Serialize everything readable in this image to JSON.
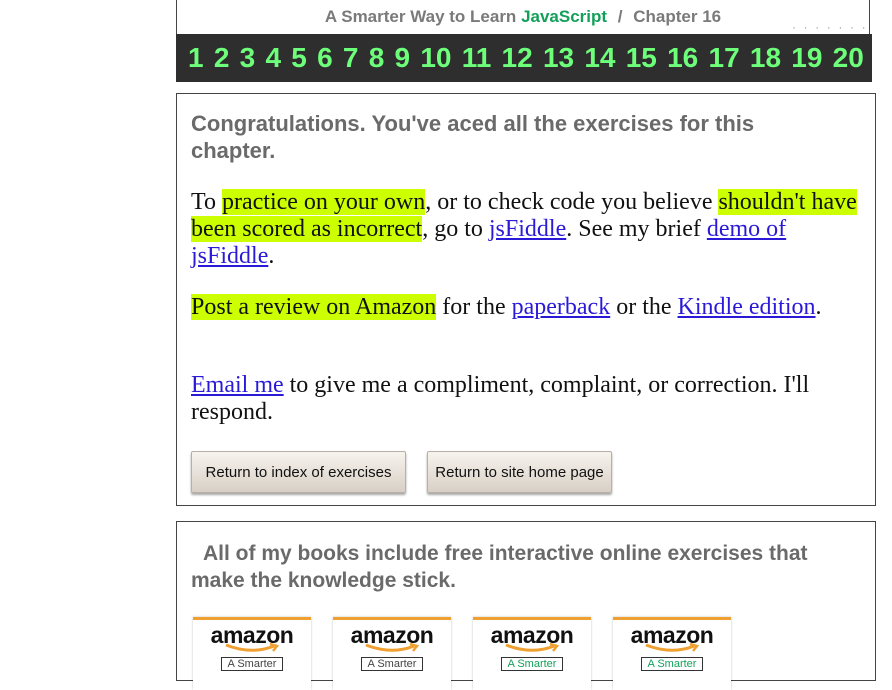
{
  "header": {
    "prefix": "A Smarter Way to Learn",
    "language": "JavaScript",
    "separator": "/",
    "chapter": "Chapter 16",
    "dots": "· · · · · · ·"
  },
  "chapters": [
    "1",
    "2",
    "3",
    "4",
    "5",
    "6",
    "7",
    "8",
    "9",
    "10",
    "11",
    "12",
    "13",
    "14",
    "15",
    "16",
    "17",
    "18",
    "19",
    "20"
  ],
  "colors": {
    "nav_bg": "#2e2e2e",
    "nav_text": "#6dff7a",
    "highlight": "#ccff00",
    "link": "#2a1ad8",
    "js_green": "#14a05a"
  },
  "main": {
    "congrats": "Congratulations. You've aced all the exercises for this chapter.",
    "p1": {
      "t1": "To ",
      "h1": "practice on your own",
      "t2": ", or to check code you believe ",
      "h2": "shouldn't have been scored as incorrect",
      "t3": ", go to ",
      "link1": "jsFiddle",
      "t4": ". See my brief ",
      "link2": "demo of jsFiddle",
      "t5": "."
    },
    "p2": {
      "h1": "Post a review on Amazon",
      "t1": " for the ",
      "link1": "paperback",
      "t2": " or the ",
      "link2": "Kindle edition",
      "t3": "."
    },
    "p3": {
      "link1": "Email me",
      "t1": " to give me a compliment, complaint, or correction. I'll respond."
    },
    "buttons": {
      "index": "Return to index of exercises",
      "home": "Return to site home page"
    }
  },
  "books": {
    "title": "All of my books include free interactive online exercises that make the knowledge stick.",
    "items": [
      {
        "logo": "amazon",
        "label": "A Smarter"
      },
      {
        "logo": "amazon",
        "label": "A Smarter"
      },
      {
        "logo": "amazon",
        "label": "A Smarter"
      },
      {
        "logo": "amazon",
        "label": "A Smarter"
      }
    ]
  }
}
